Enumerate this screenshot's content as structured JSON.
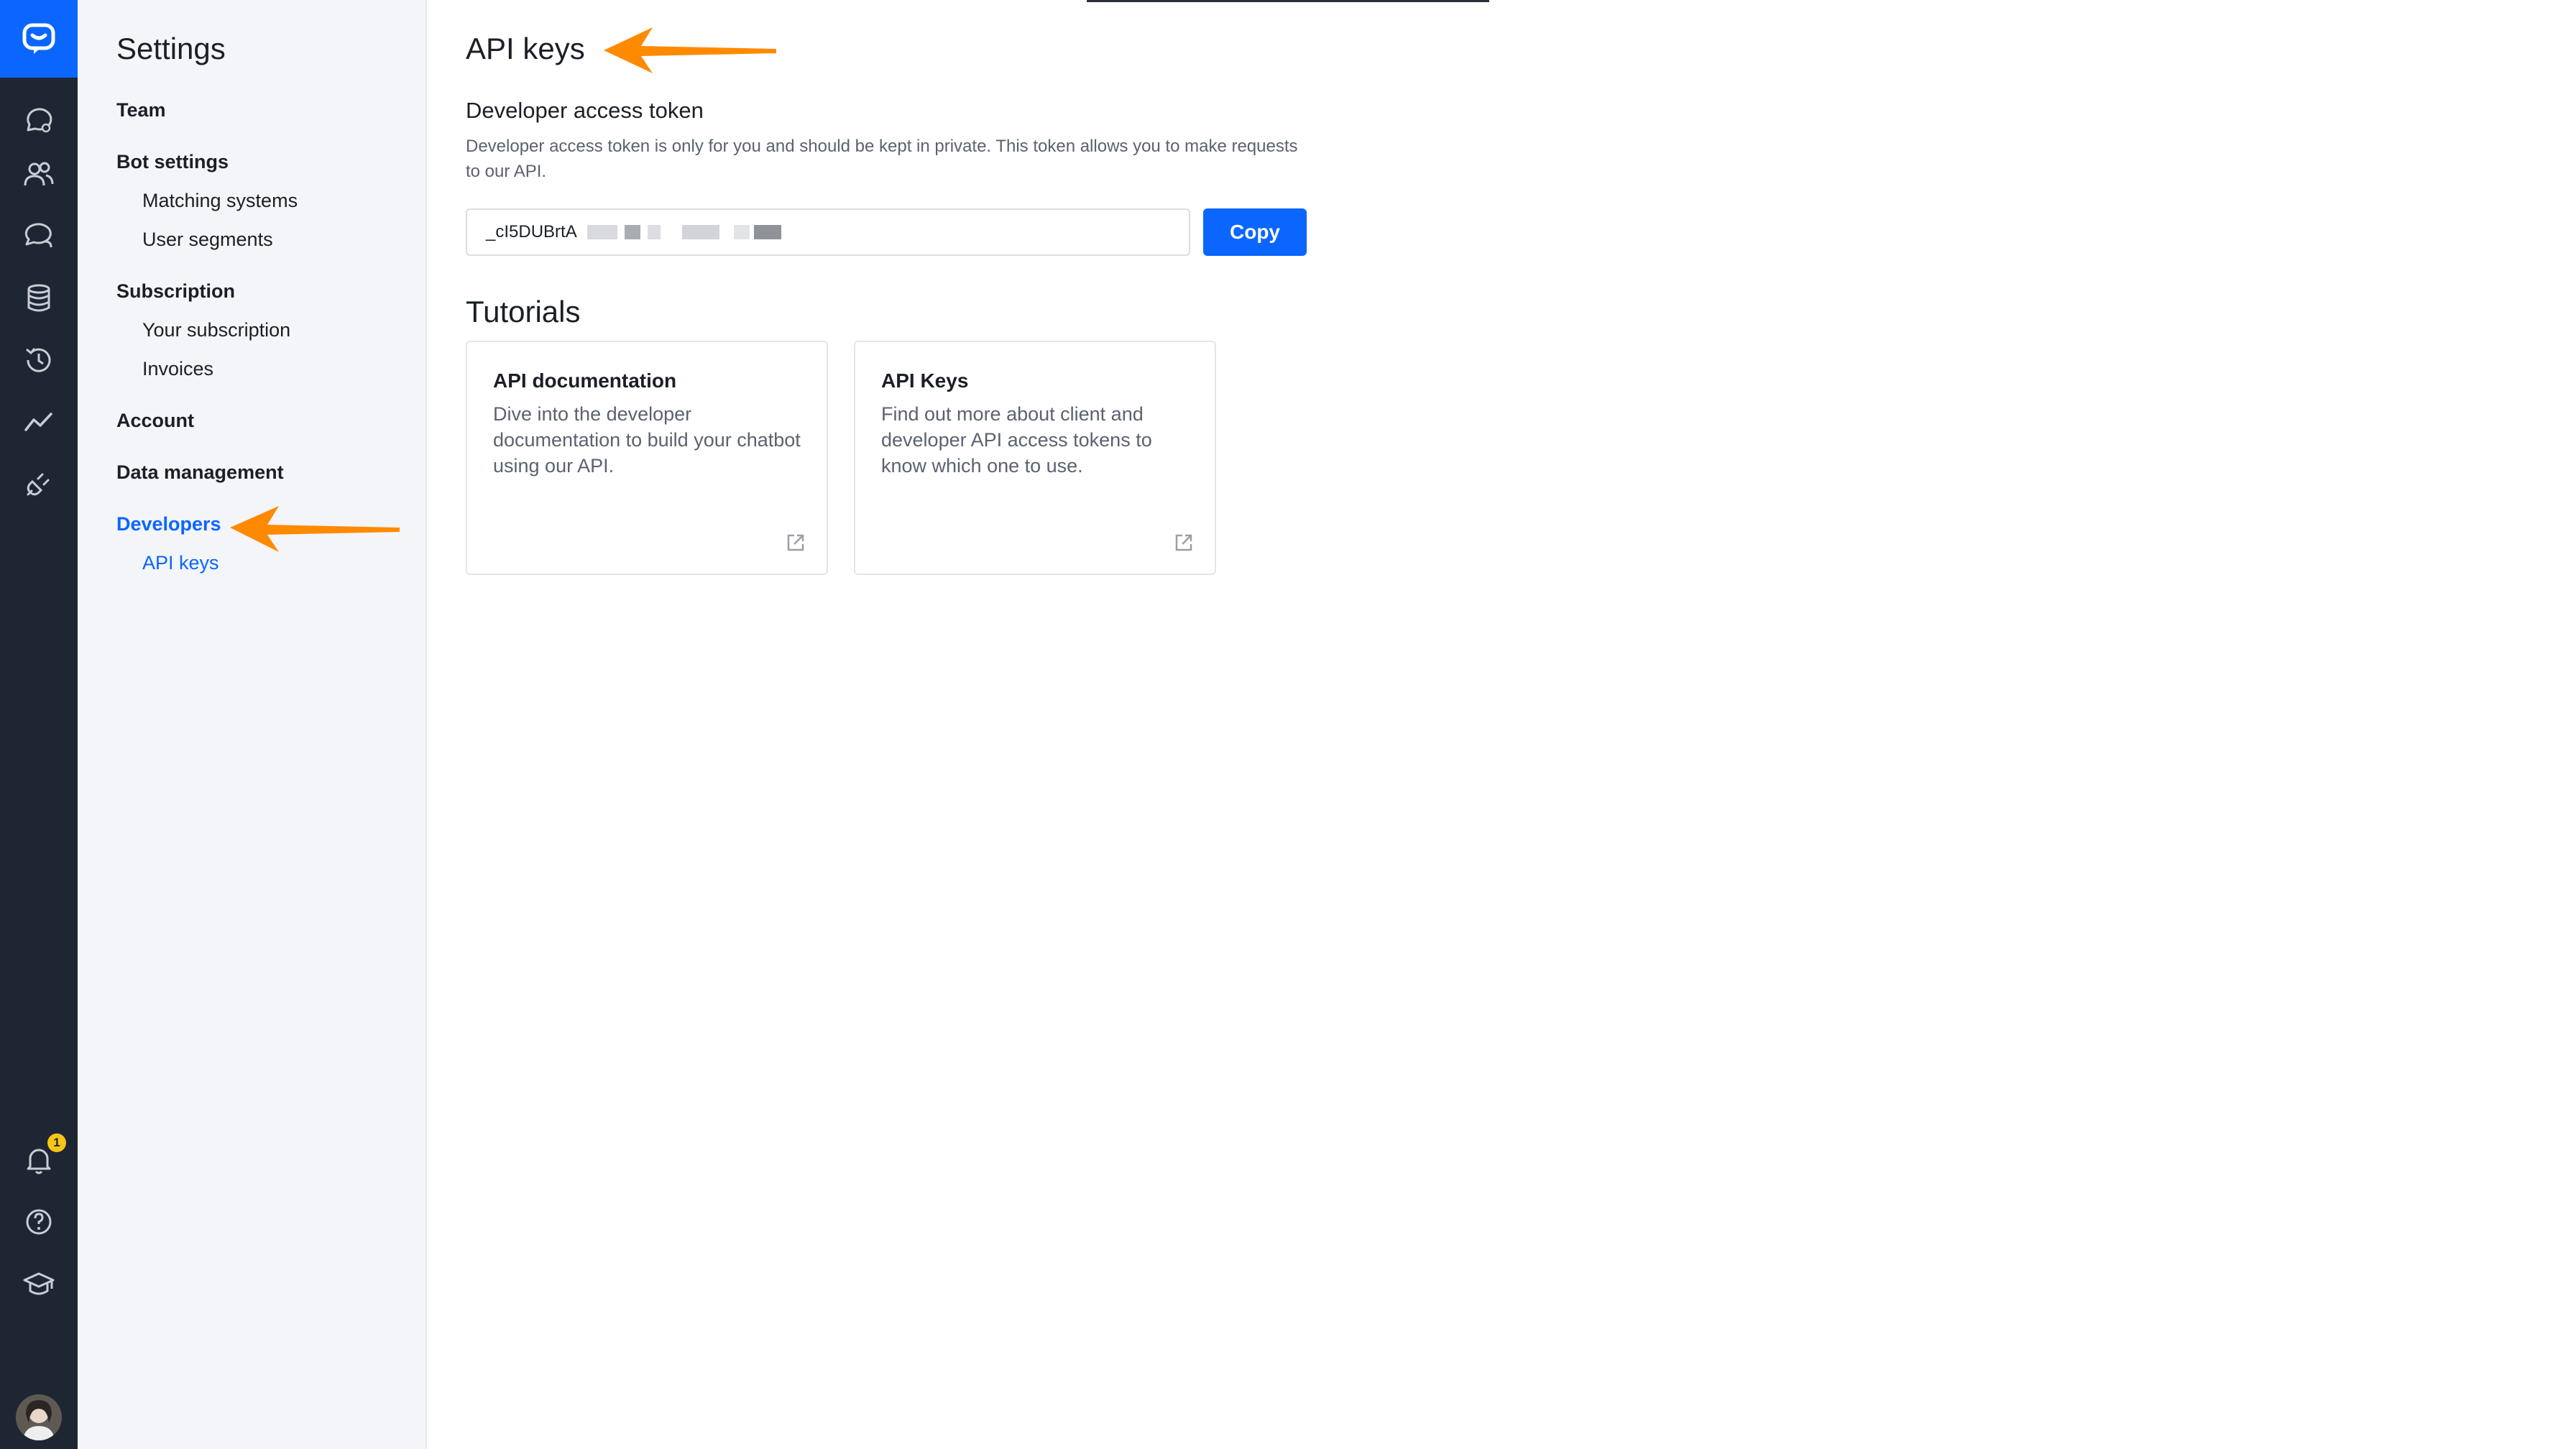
{
  "rail": {
    "icons": [
      "chat-logo-icon",
      "conversations-icon",
      "users-icon",
      "chat-bubbles-icon",
      "database-icon",
      "history-icon",
      "analytics-icon",
      "integrations-icon",
      "bell-icon",
      "help-icon",
      "academy-icon"
    ],
    "notification_count": "1"
  },
  "nav": {
    "title": "Settings",
    "team": "Team",
    "bot_settings": "Bot settings",
    "matching_systems": "Matching systems",
    "user_segments": "User segments",
    "subscription": "Subscription",
    "your_subscription": "Your subscription",
    "invoices": "Invoices",
    "account": "Account",
    "data_management": "Data management",
    "developers": "Developers",
    "api_keys": "API keys"
  },
  "main": {
    "title": "API keys",
    "token_heading": "Developer access token",
    "token_description": "Developer access token is only for you and should be kept in private. This token allows you to make requests to our API.",
    "token_value": "_cI5DUBrtA",
    "copy_label": "Copy",
    "tutorials_title": "Tutorials",
    "cards": [
      {
        "title": "API documentation",
        "description": "Dive into the developer documentation to build your chatbot using our API."
      },
      {
        "title": "API Keys",
        "description": "Find out more about client and developer API access tokens to know which one to use."
      }
    ]
  },
  "colors": {
    "rail": "#1f2633",
    "accent": "#0a66ff",
    "nav_bg": "#f3f5f8",
    "annotation_arrow": "#ff8a00",
    "badge": "#f5c518"
  }
}
